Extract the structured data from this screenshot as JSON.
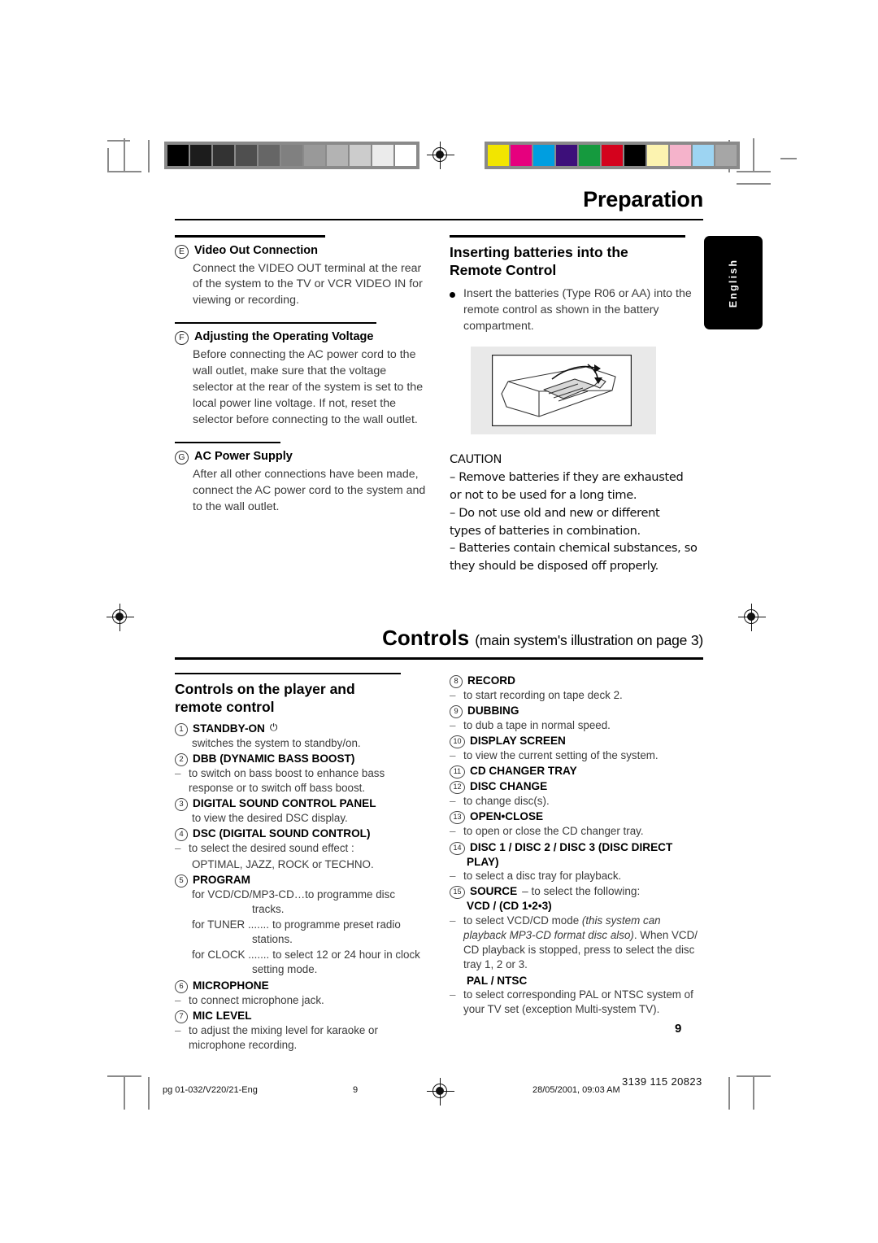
{
  "document": {
    "chapter_title": "Preparation",
    "language_tab": "English",
    "page_number": "9"
  },
  "left_column": {
    "sections": [
      {
        "marker": "E",
        "heading": "Video Out Connection",
        "body": "Connect the VIDEO OUT terminal at the rear of the system to the TV or VCR VIDEO IN for viewing or recording."
      },
      {
        "marker": "F",
        "heading": "Adjusting the Operating Voltage",
        "body": "Before connecting the AC power cord to the wall outlet, make sure that the voltage selector at the rear of the system is set to the local power line voltage. If not, reset the selector before connecting to the wall outlet."
      },
      {
        "marker": "G",
        "heading": "AC Power Supply",
        "body": "After all other connections have been made, connect the AC power cord to the system and to the wall outlet."
      }
    ]
  },
  "right_column": {
    "heading_line1": "Inserting batteries into the",
    "heading_line2": "Remote Control",
    "bullet": "Insert the batteries (Type R06 or AA) into the remote control as shown in the battery compartment.",
    "illustration_name": "remote-battery-compartment",
    "caution": {
      "title": "CAUTION",
      "lines": [
        "–  Remove batteries if they are exhausted",
        "or not to be used for a long time.",
        "–  Do not use old and new or different",
        "types of batteries in combination.",
        "–  Batteries contain chemical substances, so",
        "they should be disposed off properly."
      ]
    }
  },
  "controls": {
    "title": "Controls",
    "subtitle": "(main system's illustration on page 3)",
    "left_heading_line1": "Controls on the player and",
    "left_heading_line2": "remote control",
    "left_items": [
      {
        "num": "1",
        "label": "STANDBY-ON",
        "glyph": "⏻",
        "desc_plain": "switches the system to standby/on."
      },
      {
        "num": "2",
        "label": "DBB (DYNAMIC BASS BOOST)",
        "dash": "–",
        "desc": "to switch on bass boost to enhance bass response or to switch off bass boost."
      },
      {
        "num": "3",
        "label": "DIGITAL SOUND CONTROL PANEL",
        "desc_plain": "to view the desired DSC display."
      },
      {
        "num": "4",
        "label": "DSC (DIGITAL SOUND CONTROL)",
        "dash": "–",
        "desc": "to select the desired sound effect :",
        "desc2": "OPTIMAL,  JAZZ,  ROCK or TECHNO."
      },
      {
        "num": "5",
        "label": "PROGRAM",
        "program_lines": [
          {
            "head": "for VCD/CD/MP3-CD…",
            "text": "to programme disc",
            "cont": "tracks."
          },
          {
            "head": "for TUNER .......",
            "text": "to programme preset radio",
            "cont": "stations."
          },
          {
            "head": "for CLOCK .......",
            "text": "to select 12 or 24 hour in clock",
            "cont": "setting mode."
          }
        ]
      },
      {
        "num": "6",
        "label": "MICROPHONE",
        "dash": "–",
        "desc": "to connect microphone jack."
      },
      {
        "num": "7",
        "label": "MIC LEVEL",
        "dash": "–",
        "desc": "to adjust the mixing level for karaoke or microphone recording."
      }
    ],
    "right_items": [
      {
        "num": "8",
        "label": "RECORD",
        "dash": "–",
        "desc": "to start recording on tape deck 2."
      },
      {
        "num": "9",
        "label": "DUBBING",
        "dash": "–",
        "desc": "to dub a tape in normal speed."
      },
      {
        "num": "10",
        "label": "DISPLAY SCREEN",
        "dash": "–",
        "desc": "to view the current setting of the system."
      },
      {
        "num": "11",
        "label": "CD CHANGER TRAY"
      },
      {
        "num": "12",
        "label": "DISC CHANGE",
        "dash": "–",
        "desc": "to change disc(s)."
      },
      {
        "num": "13",
        "label": "OPEN•CLOSE",
        "dash": "–",
        "desc": "to open or close the CD changer tray."
      },
      {
        "num": "14",
        "label": "DISC 1 / DISC 2 / DISC 3 (DISC DIRECT",
        "label2": "PLAY)",
        "dash": "–",
        "desc": "to select a disc tray for playback."
      },
      {
        "num": "15",
        "label": "SOURCE",
        "label_suffix": " – to select the following:",
        "sub1": "VCD / (CD 1•2•3)"
      }
    ],
    "source_detail": {
      "dash": "–",
      "text_part1": "to select VCD/CD mode ",
      "text_italic": "(this system can playback MP3-CD format disc also)",
      "text_part2": ". When VCD/ CD playback is stopped, press to select the disc tray 1, 2 or 3.",
      "sub2": "PAL / NTSC",
      "dash2": "–",
      "text2": "to select corresponding PAL or NTSC system of your TV set (exception Multi-system TV)."
    }
  },
  "footer": {
    "file_ref": "pg 01-032/V220/21-Eng",
    "page": "9",
    "timestamp": "28/05/2001, 09:03 AM",
    "code": "3139 115 20823"
  },
  "calibration": {
    "grayscale": [
      "#000000",
      "#1c1c1c",
      "#333333",
      "#4f4f4f",
      "#666666",
      "#808080",
      "#999999",
      "#b3b3b3",
      "#cccccc",
      "#ebebeb",
      "#ffffff"
    ],
    "colors": [
      "#f2e500",
      "#e6007e",
      "#009ee0",
      "#3d0f7a",
      "#159a3e",
      "#d4021d",
      "#000000",
      "#fcf3b0",
      "#f5b3cb",
      "#9dd4f2",
      "#a6a6a6"
    ]
  }
}
